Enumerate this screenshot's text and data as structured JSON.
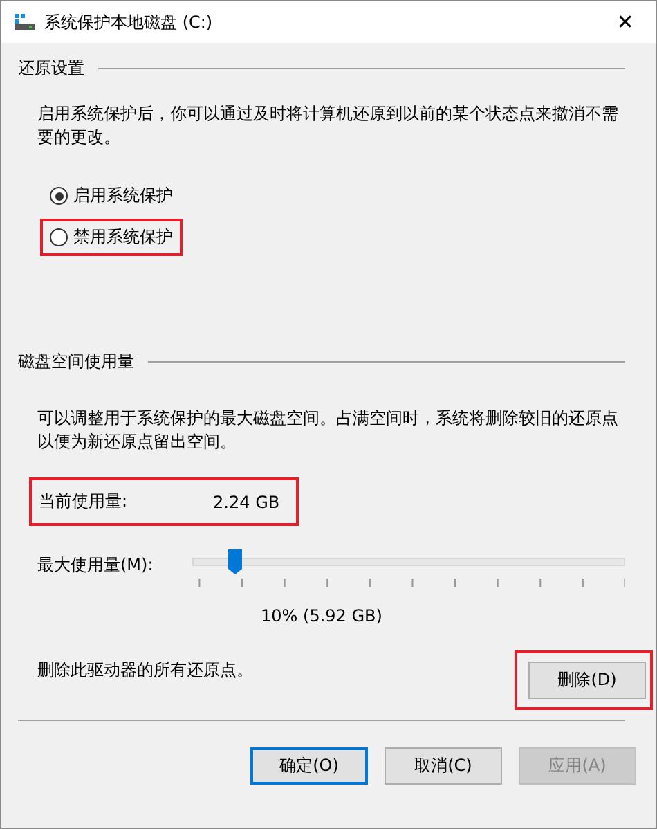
{
  "window": {
    "title": "系统保护本地磁盘 (C:)",
    "close": "✕"
  },
  "restore_settings": {
    "heading": "还原设置",
    "description": "启用系统保护后，你可以通过及时将计算机还原到以前的某个状态点来撤消不需要的更改。",
    "options": [
      {
        "label": "启用系统保护",
        "selected": true,
        "highlighted": false
      },
      {
        "label": "禁用系统保护",
        "selected": false,
        "highlighted": true
      }
    ]
  },
  "disk_usage": {
    "heading": "磁盘空间使用量",
    "description": "可以调整用于系统保护的最大磁盘空间。占满空间时，系统将删除较旧的还原点以便为新还原点留出空间。",
    "current": {
      "label": "当前使用量:",
      "value": "2.24 GB",
      "highlighted": true
    },
    "max": {
      "label": "最大使用量(M):",
      "level": 0.1,
      "reading": "10% (5.92 GB)"
    },
    "delete_text": "删除此驱动器的所有还原点。",
    "delete_button": {
      "label": "删除(D)",
      "highlighted": true
    }
  },
  "buttons": [
    {
      "label": "确定(O)",
      "default": true,
      "disabled": false
    },
    {
      "label": "取消(C)",
      "default": false,
      "disabled": false
    },
    {
      "label": "应用(A)",
      "default": false,
      "disabled": true
    }
  ]
}
